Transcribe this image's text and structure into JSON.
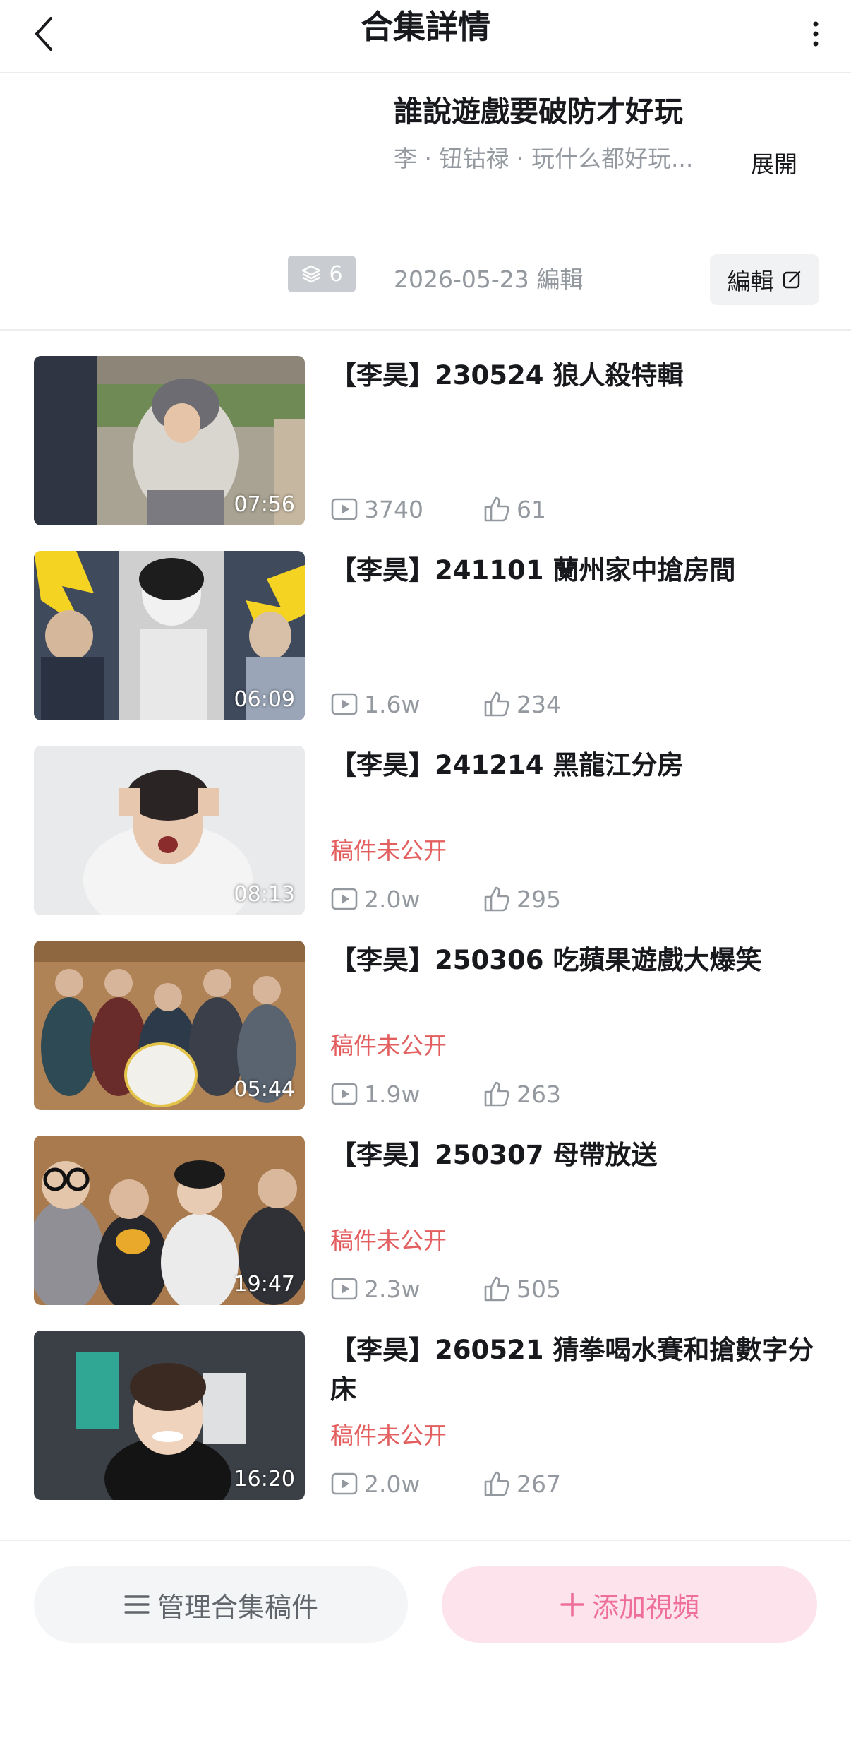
{
  "header": {
    "title": "合集詳情"
  },
  "collection": {
    "title": "誰說遊戲要破防才好玩",
    "description": "李 · 钮钴禄 · 玩什么都好玩...",
    "expand_label": "展開",
    "video_count": "6",
    "edit_date": "2026-05-23 編輯",
    "edit_label": "編輯"
  },
  "videos": [
    {
      "title": "【李昊】230524 狼人殺特輯",
      "duration": "07:56",
      "status": "",
      "views": "3740",
      "likes": "61"
    },
    {
      "title": "【李昊】241101 蘭州家中搶房間",
      "duration": "06:09",
      "status": "",
      "views": "1.6w",
      "likes": "234"
    },
    {
      "title": "【李昊】241214 黑龍江分房",
      "duration": "08:13",
      "status": "稿件未公开",
      "views": "2.0w",
      "likes": "295"
    },
    {
      "title": "【李昊】250306 吃蘋果遊戲大爆笑",
      "duration": "05:44",
      "status": "稿件未公开",
      "views": "1.9w",
      "likes": "263"
    },
    {
      "title": "【李昊】250307 母帶放送",
      "duration": "19:47",
      "status": "稿件未公开",
      "views": "2.3w",
      "likes": "505"
    },
    {
      "title": "【李昊】260521 猜拳喝水賽和搶數字分床",
      "duration": "16:20",
      "status": "稿件未公开",
      "views": "2.0w",
      "likes": "267"
    }
  ],
  "bottom": {
    "manage_label": "管理合集稿件",
    "add_label": "添加視頻"
  },
  "colors": {
    "accent_pink": "#ee6f9a",
    "status_red": "#e35f5f",
    "muted_text": "#9499a0"
  }
}
